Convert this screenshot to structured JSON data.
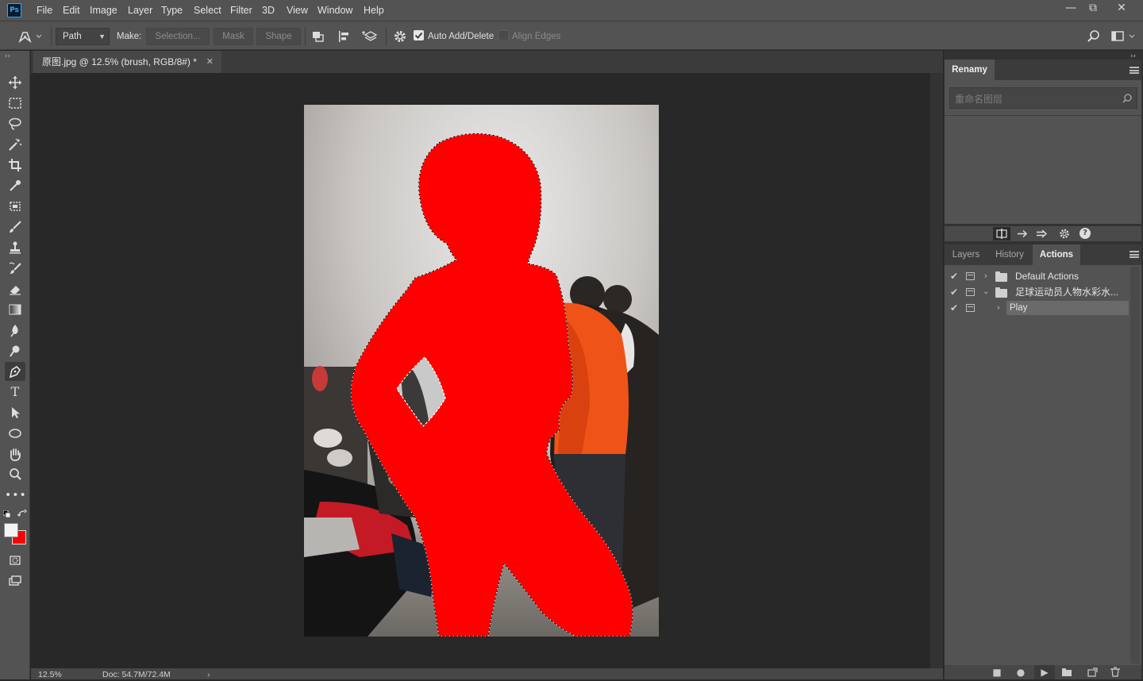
{
  "app": {
    "logo": "Ps"
  },
  "menu": [
    "File",
    "Edit",
    "Image",
    "Layer",
    "Type",
    "Select",
    "Filter",
    "3D",
    "View",
    "Window",
    "Help"
  ],
  "window_controls": {
    "minimize": "—",
    "restore": "⧉",
    "close": "✕"
  },
  "options_bar": {
    "tool_mode": "Path",
    "make_label": "Make:",
    "selection_button": "Selection...",
    "mask_button": "Mask",
    "shape_button": "Shape",
    "auto_add_delete_label": "Auto Add/Delete",
    "auto_add_delete_checked": true,
    "align_edges_label": "Align Edges",
    "align_edges_checked": false
  },
  "document": {
    "tab_title": "原图.jpg @ 12.5% (brush, RGB/8#) *",
    "zoom": "12.5%",
    "doc_info": "Doc: 54.7M/72.4M"
  },
  "renamy_panel": {
    "tab": "Renamy",
    "search_placeholder": "重命名图层"
  },
  "actions_panel": {
    "tabs": [
      "Layers",
      "History",
      "Actions"
    ],
    "active_tab": "Actions",
    "rows": [
      {
        "label": "Default Actions",
        "type": "set",
        "expanded": false
      },
      {
        "label": "足球运动员人物水彩水...",
        "type": "set",
        "expanded": true
      },
      {
        "label": "Play",
        "type": "action",
        "expanded": false,
        "selected": true
      }
    ]
  },
  "colors": {
    "accent_ps": "#31a8ff",
    "foreground": "#ffffff",
    "background": "#ff0000",
    "mask_red": "#ff0000"
  },
  "tools": [
    "move-icon",
    "marquee-icon",
    "lasso-icon",
    "magic-wand-icon",
    "crop-icon",
    "eyedropper-icon",
    "frame-icon",
    "brush-icon",
    "stamp-icon",
    "history-brush-icon",
    "eraser-icon",
    "gradient-icon",
    "blur-icon",
    "dodge-icon",
    "pen-icon",
    "type-icon",
    "path-select-icon",
    "ellipse-icon",
    "hand-icon",
    "zoom-icon",
    "more-icon"
  ]
}
